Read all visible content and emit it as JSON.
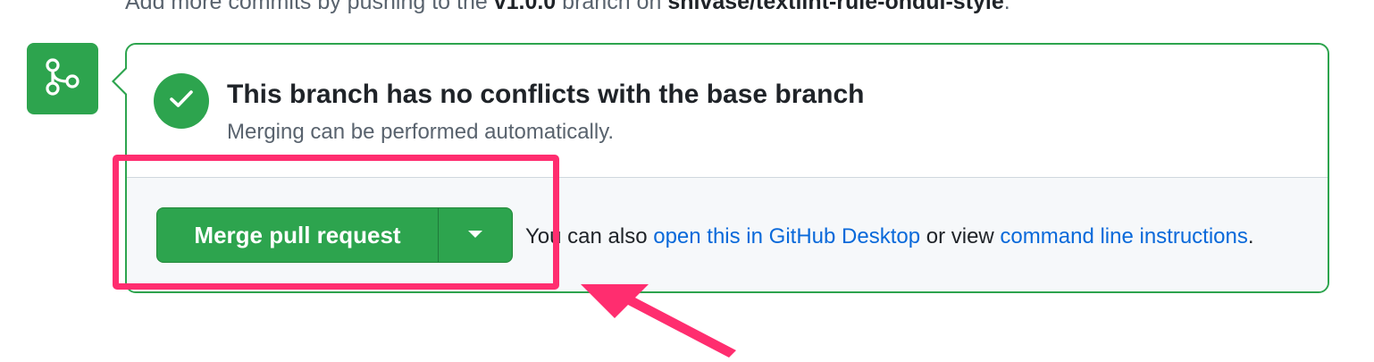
{
  "header": {
    "text_before": "Add more commits by pushing to the ",
    "branch": "v1.0.0",
    "text_middle": " branch on ",
    "repo": "shivase/textlint-rule-ondul-style",
    "text_after": "."
  },
  "merge_status": {
    "title": "This branch has no conflicts with the base branch",
    "subtitle": "Merging can be performed automatically."
  },
  "actions": {
    "merge_button_label": "Merge pull request",
    "help_prefix": "You can also ",
    "desktop_link": "open this in GitHub Desktop",
    "help_middle": " or view ",
    "cli_link": "command line instructions",
    "help_suffix": "."
  },
  "annotation": {
    "highlight_color": "#ff2d6f"
  },
  "colors": {
    "success": "#2da44e",
    "link": "#0969da"
  },
  "icons": {
    "badge": "git-merge-icon",
    "status": "check-icon",
    "dropdown": "triangle-down-icon"
  }
}
